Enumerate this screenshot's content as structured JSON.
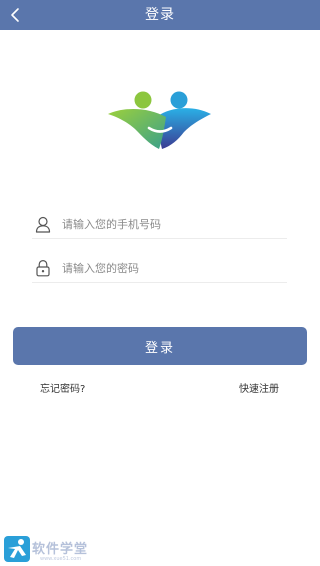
{
  "header": {
    "title": "登录",
    "back_icon": "chevron-left-icon",
    "bar_color": "#5a76ac"
  },
  "logo": {
    "icon": "two-people-logo"
  },
  "form": {
    "phone": {
      "placeholder": "请输入您的手机号码",
      "value": "",
      "icon": "user-icon"
    },
    "password": {
      "placeholder": "请输入您的密码",
      "value": "",
      "icon": "lock-icon"
    },
    "login_label": "登录",
    "forgot_label": "忘记密码?",
    "register_label": "快速注册"
  },
  "watermark": {
    "text": "软件学堂",
    "sub": "www.xue51.com"
  },
  "colors": {
    "accent": "#5a76ac",
    "logo_green": "#8cc63e",
    "logo_blue": "#2a9fd8",
    "logo_purple": "#3d3a8e"
  }
}
